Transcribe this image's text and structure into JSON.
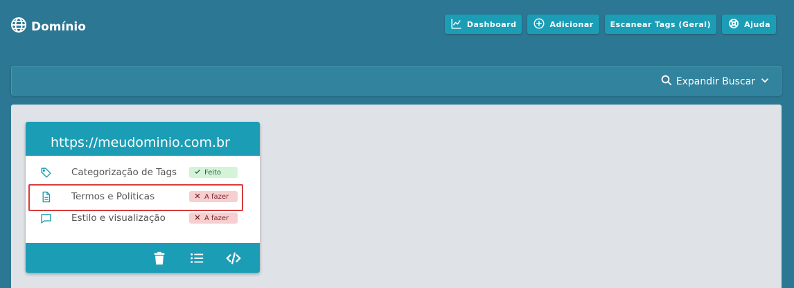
{
  "header": {
    "brand": "Domínio",
    "buttons": [
      {
        "label": "Dashboard",
        "icon": "chart-line-icon"
      },
      {
        "label": "Adicionar",
        "icon": "plus-circle-icon"
      },
      {
        "label": "Escanear Tags (Geral)"
      },
      {
        "label": "Ajuda",
        "icon": "lifebuoy-icon"
      }
    ]
  },
  "search": {
    "expand_label": "Expandir Buscar"
  },
  "card": {
    "domain": "https://meudominio.com.br",
    "items": [
      {
        "label": "Categorização de Tags",
        "status": "Feito",
        "icon": "tag-icon"
      },
      {
        "label": "Termos e Politicas",
        "status": "A fazer",
        "icon": "document-icon"
      },
      {
        "label": "Estilo e visualização",
        "status": "A fazer",
        "icon": "comment-icon"
      }
    ],
    "footer_icons": [
      "trash-icon",
      "list-icon",
      "code-icon"
    ]
  },
  "colors": {
    "background": "#2c7793",
    "accent": "#1b9db5",
    "done_badge": "#d4f4da",
    "todo_badge": "#f6cfd0",
    "highlight": "#d93a3a"
  }
}
